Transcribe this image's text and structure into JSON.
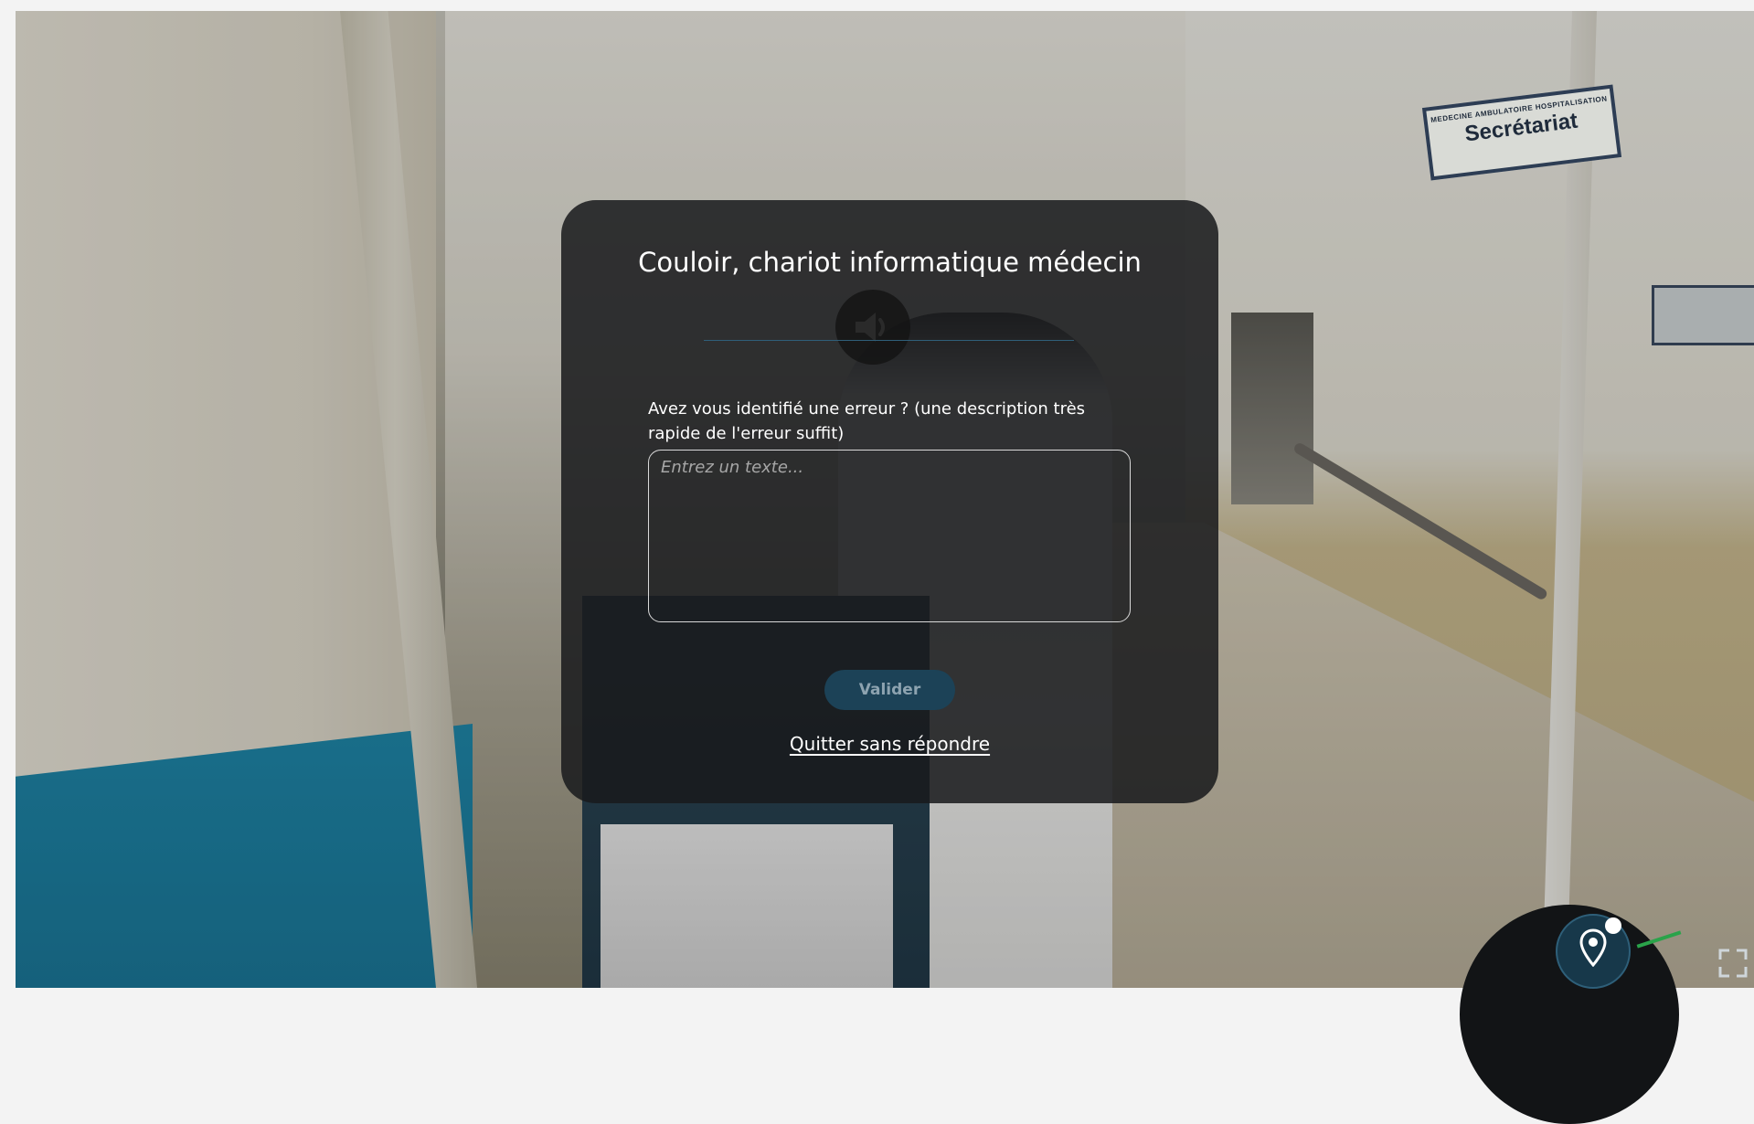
{
  "scene": {
    "signs": {
      "secretariat_small": "MEDECINE AMBULATOIRE HOSPITALISATION",
      "secretariat_big": "Secrétariat"
    }
  },
  "modal": {
    "title": "Couloir, chariot informatique médecin",
    "question": "Avez vous identifié une erreur ? (une description très rapide de l'erreur suffit)",
    "answer_placeholder": "Entrez un texte...",
    "answer_value": "",
    "submit_label": "Valider",
    "quit_label": "Quitter sans répondre",
    "icons": {
      "sound": "speaker-icon"
    }
  },
  "controls": {
    "location": "location-pin-icon",
    "fullscreen": "fullscreen-icon"
  },
  "colors": {
    "modal_bg": "#181a1c",
    "accent": "#1c4257",
    "divider": "#2f5f7a",
    "wall_blue": "#1f86a8",
    "map_green": "#2aa34a"
  }
}
